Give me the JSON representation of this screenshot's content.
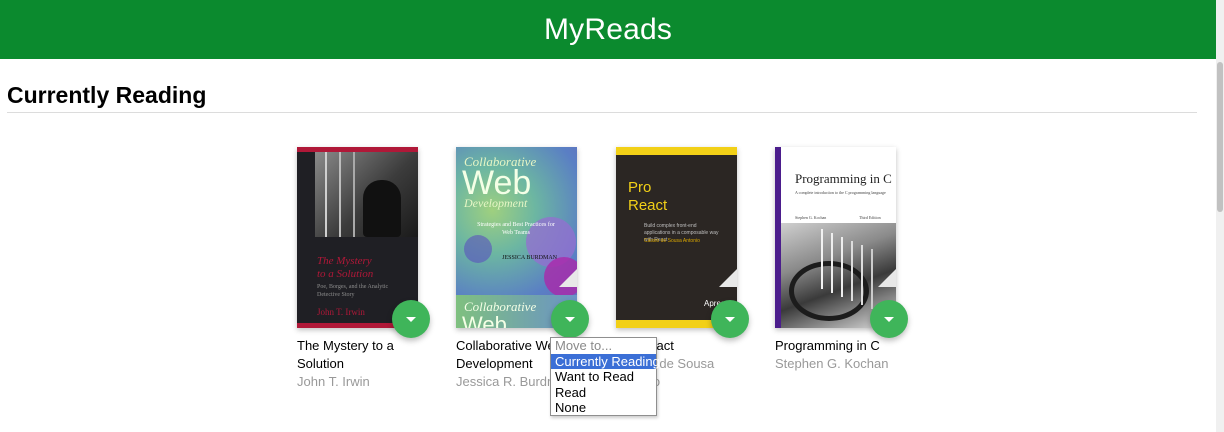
{
  "header": {
    "title": "MyReads"
  },
  "shelf": {
    "title": "Currently Reading",
    "books": [
      {
        "title": "The Mystery to a Solution",
        "authors": "John T. Irwin",
        "cover": {
          "lines": [
            "The Mystery",
            "to a Solution"
          ],
          "subtitle": "Poe, Borges, and the Analytic Detective Story",
          "author": "John T. Irwin"
        }
      },
      {
        "title": "Collaborative Web Development",
        "authors": "Jessica R. Burdman",
        "cover": {
          "line1": "Collaborative",
          "line2": "Web",
          "line3": "Development",
          "tagline": "Strategies and Best Practices for Web Teams",
          "author": "JESSICA BURDMAN",
          "strip1": "Collaborative",
          "strip2": "Web"
        }
      },
      {
        "title": "Pro React",
        "authors": "Cássio de Sousa Antonio",
        "cover": {
          "line1": "Pro",
          "line2": "React",
          "tagline": "Build complex front-end applications in a composable way with React",
          "author": "Cássio de Sousa Antonio",
          "publisher": "Apress"
        }
      },
      {
        "title": "Programming in C",
        "authors": "Stephen G. Kochan",
        "cover": {
          "title": "Programming in C",
          "tagline": "A complete introduction to the C programming language",
          "author": "Stephen G. Kochan",
          "edition": "Third Edition"
        }
      }
    ]
  },
  "menu": {
    "options": [
      {
        "label": "Move to...",
        "disabled": true
      },
      {
        "label": "Currently Reading",
        "selected": true
      },
      {
        "label": "Want to Read"
      },
      {
        "label": "Read"
      },
      {
        "label": "None"
      }
    ]
  },
  "colors": {
    "header": "#0b8a2e",
    "changer": "#3fb55a",
    "selection": "#3b6fd6"
  },
  "icons": {
    "changer": "triangle-down-icon"
  }
}
